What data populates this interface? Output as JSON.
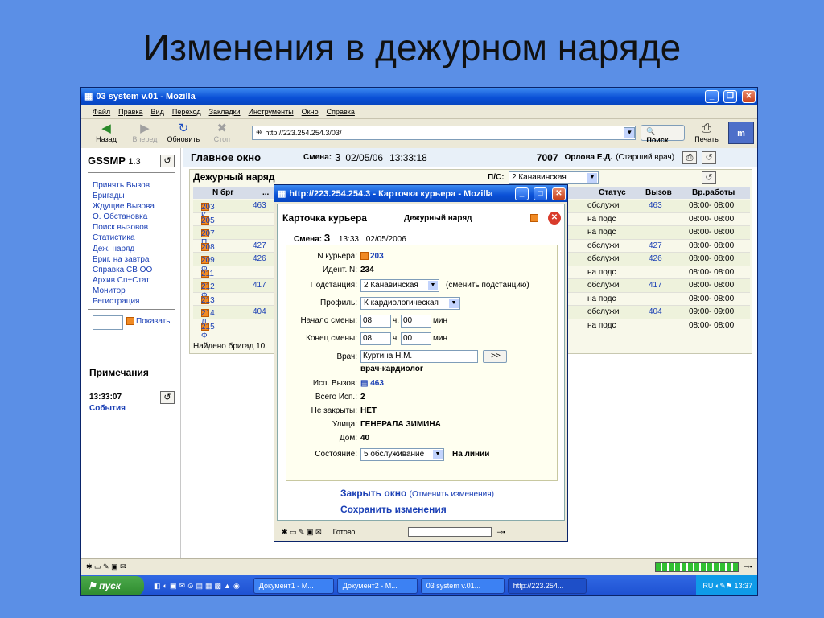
{
  "slide_title": "Изменения в дежурном наряде",
  "window": {
    "title": "03 system v.01 - Mozilla"
  },
  "menu": [
    "Файл",
    "Правка",
    "Вид",
    "Переход",
    "Закладки",
    "Инструменты",
    "Окно",
    "Справка"
  ],
  "toolbar": {
    "back": "Назад",
    "forward": "Вперед",
    "reload": "Обновить",
    "stop": "Стоп",
    "url": "http://223.254.254.3/03/",
    "search": "Поиск",
    "print": "Печать"
  },
  "left": {
    "app": "GSSMP",
    "version": "1.3",
    "items": [
      "Принять Вызов",
      "Бригады",
      "Ждущие Вызова",
      "О. Обстановка",
      "Поиск вызовов",
      "Статистика",
      "Деж. наряд",
      "Бриг. на завтра",
      "Справка СВ ОО",
      "Архив Сп+Стат",
      "Монитор",
      "Регистрация"
    ],
    "show_button": "Показать",
    "notes_title": "Примечания",
    "notes_time": "13:33:07",
    "notes_events": "События"
  },
  "main": {
    "title": "Главное окно",
    "shift_label": "Смена:",
    "shift_num": "3",
    "date": "02/05/06",
    "time": "13:33:18",
    "code": "7007",
    "user": "Орлова Е.Д.",
    "role": "(Старший врач)",
    "duty_title": "Дежурный наряд",
    "ps_label": "П/С:",
    "ps_value": "2 Канавинская",
    "found": "Найдено бригад 10."
  },
  "table": {
    "headers": {
      "num": "N брг",
      "more": "...",
      "status": "Статус",
      "call": "Вызов",
      "work": "Вр.работы"
    },
    "rows": [
      {
        "num": "203 К",
        "c2": "463",
        "status": "обслужи",
        "call": "463",
        "work": "08:00- 08:00"
      },
      {
        "num": "205 Е",
        "c2": "",
        "status": "на подс",
        "call": "",
        "work": "08:00- 08:00"
      },
      {
        "num": "207 П",
        "c2": "",
        "status": "на подс",
        "call": "",
        "work": "08:00- 08:00"
      },
      {
        "num": "208 Б",
        "c2": "427",
        "status": "обслужи",
        "call": "427",
        "work": "08:00- 08:00"
      },
      {
        "num": "209 Ф",
        "c2": "426",
        "status": "обслужи",
        "call": "426",
        "work": "08:00- 08:00"
      },
      {
        "num": "211 Л",
        "c2": "",
        "status": "на подс",
        "call": "",
        "work": "08:00- 08:00"
      },
      {
        "num": "212 Ф",
        "c2": "417",
        "status": "обслужи",
        "call": "417",
        "work": "08:00- 08:00"
      },
      {
        "num": "213 Ф",
        "c2": "",
        "status": "на подс",
        "call": "",
        "work": "08:00- 08:00"
      },
      {
        "num": "214 Л",
        "c2": "404",
        "status": "обслужи",
        "call": "404",
        "work": "09:00- 09:00"
      },
      {
        "num": "215 Ф",
        "c2": "",
        "status": "на подс",
        "call": "",
        "work": "08:00- 08:00"
      }
    ]
  },
  "popup": {
    "title": "http://223.254.254.3 - Карточка курьера - Mozilla",
    "card_title": "Карточка курьера",
    "card_sub": "Дежурный наряд",
    "shift_label": "Смена:",
    "shift_num": "3",
    "shift_time": "13:33",
    "shift_date": "02/05/2006",
    "fields": {
      "courier_label": "N курьера:",
      "courier": "203",
      "ident_label": "Идент. N:",
      "ident": "234",
      "sub_label": "Подстанция:",
      "sub_value": "2 Канавинская",
      "sub_change": "(сменить подстанцию)",
      "profile_label": "Профиль:",
      "profile_value": "К кардиологическая",
      "start_label": "Начало смены:",
      "start_h": "08",
      "start_m": "00",
      "end_label": "Конец смены:",
      "end_h": "08",
      "end_m": "00",
      "h": "ч.",
      "min": "мин",
      "doctor_label": "Врач:",
      "doctor": "Куртина Н.М.",
      "doctor_btn": ">>",
      "doctor_spec": "врач-кардиолог",
      "isp_label": "Исп. Вызов:",
      "isp": "463",
      "total_label": "Всего Исп.:",
      "total": "2",
      "notclosed_label": "Не закрыты:",
      "notclosed": "НЕТ",
      "street_label": "Улица:",
      "street": "ГЕНЕРАЛА ЗИМИНА",
      "house_label": "Дом:",
      "house": "40",
      "state_label": "Состояние:",
      "state_value": "5 обслуживание",
      "state_line": "На линии"
    },
    "close": "Закрыть окно",
    "cancel": "(Отменить изменения)",
    "save": "Сохранить изменения",
    "status": "Готово"
  },
  "taskbar": {
    "start": "пуск",
    "tasks": [
      "Документ1 - М...",
      "Документ2 - М...",
      "03 system v.01...",
      "http://223.254..."
    ],
    "lang": "RU",
    "clock": "13:37"
  }
}
